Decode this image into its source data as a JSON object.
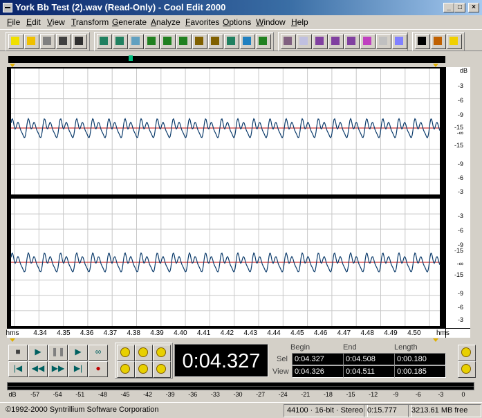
{
  "window": {
    "title": "York Bb Test (2).wav (Read-Only) - Cool Edit 2000",
    "min_label": "_",
    "max_label": "□",
    "close_label": "×"
  },
  "menu": [
    "File",
    "Edit",
    "View",
    "Transform",
    "Generate",
    "Analyze",
    "Favorites",
    "Options",
    "Window",
    "Help"
  ],
  "toolbar": {
    "groups": [
      [
        "new-icon",
        "open-icon",
        "save-icon",
        "save-as-icon",
        "save-all-icon"
      ],
      [
        "undo-icon",
        "repeat-icon",
        "cut-silence-icon",
        "select-icon",
        "copy-icon",
        "cut-icon",
        "paste-icon",
        "paste-mix-icon",
        "mix-paste-icon",
        "insert-icon",
        "trim-icon"
      ],
      [
        "spectral-view-icon",
        "checkbox-icon",
        "waveform-view-icon",
        "multitrack-icon",
        "cue-list-icon",
        "play-list-icon",
        "info-icon",
        "cd-icon"
      ],
      [
        "favorites-icon",
        "settings-icon",
        "help-icon"
      ]
    ]
  },
  "waveform": {
    "db_labels_top": [
      "dB",
      "-3",
      "-6",
      "-9",
      "-15",
      "-∞",
      "-15",
      "-9",
      "-6",
      "-3"
    ],
    "db_labels_bottom": [
      "-3",
      "-6",
      "-9",
      "-15",
      "-∞",
      "-15",
      "-9",
      "-6",
      "-3"
    ],
    "ruler_unit": "hms",
    "ruler_labels": [
      "4.34",
      "4.35",
      "4.36",
      "4.37",
      "4.38",
      "4.39",
      "4.40",
      "4.41",
      "4.42",
      "4.43",
      "4.44",
      "4.45",
      "4.46",
      "4.47",
      "4.48",
      "4.49",
      "4.50"
    ],
    "colors": {
      "background": "#ffffff",
      "wave": "#0a3a6a",
      "center": "#c00000",
      "grid": "#c8c8c8",
      "selection_edge": "#000000"
    }
  },
  "transport": {
    "buttons": [
      "stop-icon",
      "play-icon",
      "pause-icon",
      "play-to-end-icon",
      "loop-icon",
      "goto-start-icon",
      "rewind-icon",
      "fast-forward-icon",
      "goto-end-icon",
      "record-icon"
    ],
    "current_time": "0:04.327"
  },
  "selection": {
    "headers": {
      "begin": "Begin",
      "end": "End",
      "length": "Length"
    },
    "sel_label": "Sel",
    "view_label": "View",
    "sel": {
      "begin": "0:04.327",
      "end": "0:04.508",
      "length": "0:00.180"
    },
    "view": {
      "begin": "0:04.326",
      "end": "0:04.511",
      "length": "0:00.185"
    }
  },
  "meter": {
    "labels": [
      "dB",
      "-57",
      "-54",
      "-51",
      "-48",
      "-45",
      "-42",
      "-39",
      "-36",
      "-33",
      "-30",
      "-27",
      "-24",
      "-21",
      "-18",
      "-15",
      "-12",
      "-9",
      "-6",
      "-3",
      "0"
    ]
  },
  "status": {
    "copyright": "©1992-2000 Syntrillium Software Corporation",
    "format": "44100 · 16-bit · Stereo",
    "length": "0:15.777",
    "free": "3213.61 MB free"
  }
}
